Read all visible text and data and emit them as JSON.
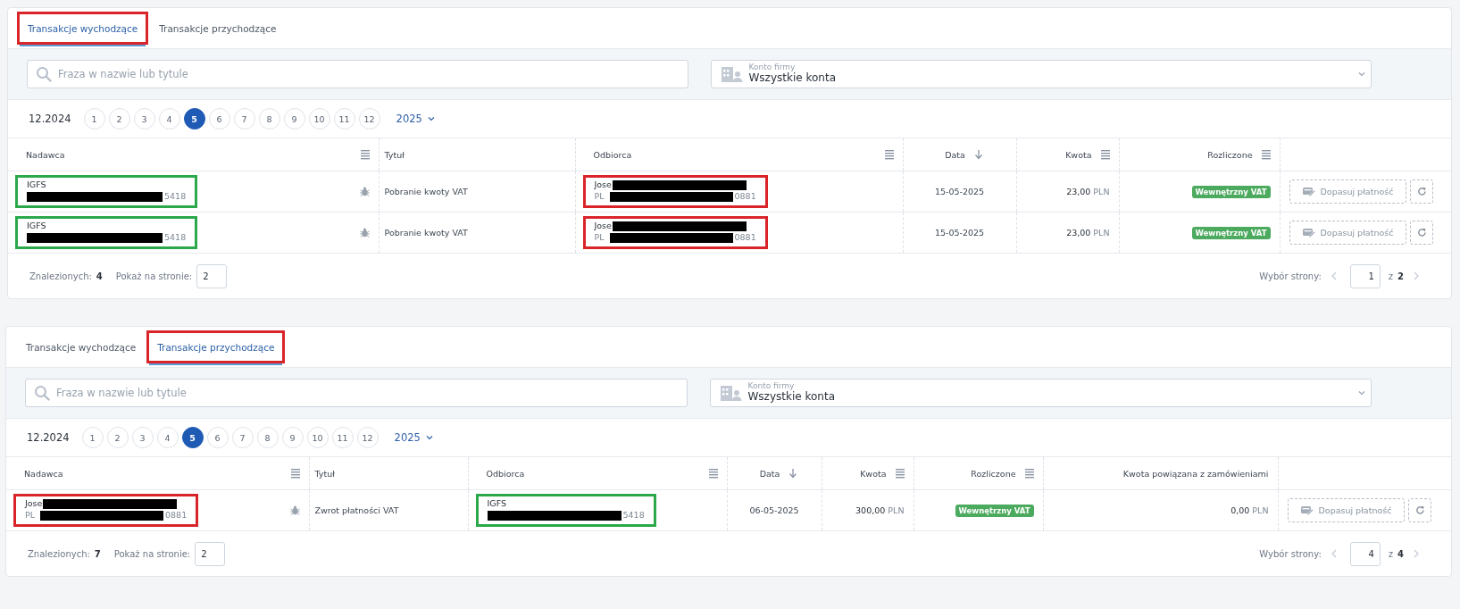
{
  "panels": [
    {
      "tabs": [
        {
          "label": "Transakcje wychodzące",
          "selected": true,
          "color": "#d9252a"
        },
        {
          "label": "Transakcje przychodzące",
          "selected": false
        }
      ],
      "search": {
        "placeholder": "Fraza w nazwie lub tytule"
      },
      "account_select": {
        "label": "Konto firmy",
        "value": "Wszystkie konta"
      },
      "months": {
        "label": "12.2024",
        "year": "2025",
        "items": [
          {
            "label": "1",
            "selected": false
          },
          {
            "label": "2",
            "selected": false
          },
          {
            "label": "3",
            "selected": false
          },
          {
            "label": "4",
            "selected": false
          },
          {
            "label": "5",
            "selected": true
          },
          {
            "label": "6",
            "selected": false
          },
          {
            "label": "7",
            "selected": false
          },
          {
            "label": "8",
            "selected": false
          },
          {
            "label": "9",
            "selected": false
          },
          {
            "label": "10",
            "selected": false
          },
          {
            "label": "11",
            "selected": false
          },
          {
            "label": "12",
            "selected": false
          }
        ]
      },
      "table": {
        "columns": [
          {
            "label": "Nadawca",
            "kind": "party",
            "menu": true
          },
          {
            "label": "Tytuł",
            "kind": "text"
          },
          {
            "label": "Odbiorca",
            "kind": "party",
            "menu": true
          },
          {
            "label": "Data",
            "kind": "date",
            "sort": true
          },
          {
            "label": "Kwota",
            "kind": "amount",
            "menu": true
          },
          {
            "label": "Rozliczone",
            "kind": "badge",
            "menu": true
          }
        ],
        "rows": [
          {
            "cells": [
              {
                "kind": "party",
                "name": "IGFS",
                "account_redacted": true,
                "account_suffix": "5418",
                "flagged": true,
                "color": "#2aa84a"
              },
              {
                "kind": "text",
                "text": "Pobranie kwoty VAT"
              },
              {
                "kind": "party",
                "name": "Jose",
                "name_redacted": true,
                "account_prefix": "PL",
                "account_redacted": true,
                "account_suffix": "0881",
                "color": "#d9252a"
              },
              {
                "kind": "date",
                "text": "15-05-2025"
              },
              {
                "kind": "amount",
                "value": "23,00",
                "currency": "PLN"
              },
              {
                "kind": "badge",
                "text": "Wewnętrzny VAT"
              },
              {
                "kind": "action",
                "label": "Dopasuj płatność"
              }
            ]
          },
          {
            "cells": [
              {
                "kind": "party",
                "name": "IGFS",
                "account_redacted": true,
                "account_suffix": "5418",
                "flagged": true,
                "color": "#2aa84a"
              },
              {
                "kind": "text",
                "text": "Pobranie kwoty VAT"
              },
              {
                "kind": "party",
                "name": "Jose",
                "name_redacted": true,
                "account_prefix": "PL",
                "account_redacted": true,
                "account_suffix": "0881",
                "color": "#d9252a"
              },
              {
                "kind": "date",
                "text": "15-05-2025"
              },
              {
                "kind": "amount",
                "value": "23,00",
                "currency": "PLN"
              },
              {
                "kind": "badge",
                "text": "Wewnętrzny VAT"
              },
              {
                "kind": "action",
                "label": "Dopasuj płatność"
              }
            ]
          }
        ]
      },
      "footer": {
        "found_label": "Znalezionych:",
        "found": "4",
        "per_page_label": "Pokaż na stronie:",
        "per_page": "2",
        "page_label": "Wybór strony:",
        "page": "1",
        "of_label": "z",
        "pages": "2"
      }
    },
    {
      "tabs": [
        {
          "label": "Transakcje wychodzące",
          "selected": false
        },
        {
          "label": "Transakcje przychodzące",
          "selected": true,
          "color": "#d9252a"
        }
      ],
      "search": {
        "placeholder": "Fraza w nazwie lub tytule"
      },
      "account_select": {
        "label": "Konto firmy",
        "value": "Wszystkie konta"
      },
      "months": {
        "label": "12.2024",
        "year": "2025",
        "items": [
          {
            "label": "1",
            "selected": false
          },
          {
            "label": "2",
            "selected": false
          },
          {
            "label": "3",
            "selected": false
          },
          {
            "label": "4",
            "selected": false
          },
          {
            "label": "5",
            "selected": true
          },
          {
            "label": "6",
            "selected": false
          },
          {
            "label": "7",
            "selected": false
          },
          {
            "label": "8",
            "selected": false
          },
          {
            "label": "9",
            "selected": false
          },
          {
            "label": "10",
            "selected": false
          },
          {
            "label": "11",
            "selected": false
          },
          {
            "label": "12",
            "selected": false
          }
        ]
      },
      "table": {
        "columns": [
          {
            "label": "Nadawca",
            "kind": "party",
            "menu": true
          },
          {
            "label": "Tytuł",
            "kind": "text"
          },
          {
            "label": "Odbiorca",
            "kind": "party",
            "menu": true
          },
          {
            "label": "Data",
            "kind": "date",
            "sort": true
          },
          {
            "label": "Kwota",
            "kind": "amount",
            "menu": true
          },
          {
            "label": "Rozliczone",
            "kind": "badge",
            "menu": true
          },
          {
            "label": "Kwota powiązana z zamówieniami",
            "kind": "amount"
          }
        ],
        "rows": [
          {
            "cells": [
              {
                "kind": "party",
                "name": "Jose",
                "name_redacted": true,
                "account_prefix": "PL",
                "account_redacted": true,
                "account_suffix": "0881",
                "flagged": true,
                "color": "#d9252a"
              },
              {
                "kind": "text",
                "text": "Zwrot płatności VAT"
              },
              {
                "kind": "party",
                "name": "IGFS",
                "account_redacted": true,
                "account_suffix": "5418",
                "color": "#2aa84a"
              },
              {
                "kind": "date",
                "text": "06-05-2025"
              },
              {
                "kind": "amount",
                "value": "300,00",
                "currency": "PLN"
              },
              {
                "kind": "badge",
                "text": "Wewnętrzny VAT"
              },
              {
                "kind": "amount",
                "value": "0,00",
                "currency": "PLN"
              },
              {
                "kind": "action",
                "label": "Dopasuj płatność"
              }
            ]
          }
        ]
      },
      "footer": {
        "found_label": "Znalezionych:",
        "found": "7",
        "per_page_label": "Pokaż na stronie:",
        "per_page": "2",
        "page_label": "Wybór strony:",
        "page": "4",
        "of_label": "z",
        "pages": "4"
      }
    }
  ]
}
